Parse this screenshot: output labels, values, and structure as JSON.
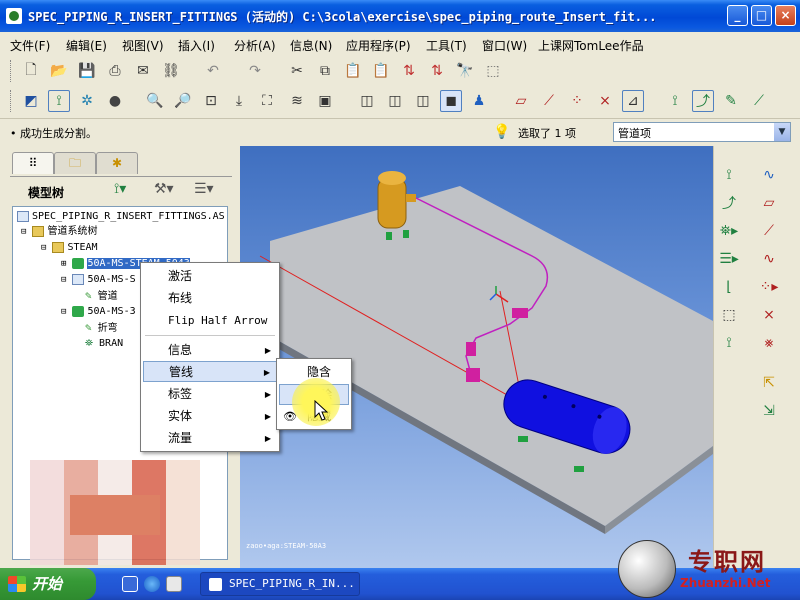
{
  "window": {
    "title": "SPEC_PIPING_R_INSERT_FITTINGS (活动的) C:\\3cola\\exercise\\spec_piping_route_Insert_fit...",
    "min": "_",
    "max": "□",
    "close": "×"
  },
  "menu": [
    "文件(F)",
    "编辑(E)",
    "视图(V)",
    "插入(I)",
    "分析(A)",
    "信息(N)",
    "应用程序(P)",
    "工具(T)",
    "窗口(W)",
    "上课网TomLee作品"
  ],
  "status": {
    "message": "• 成功生成分割。",
    "selected": "选取了 1 项",
    "filter_value": "管道项"
  },
  "panel": {
    "model_tree_label": "模型树"
  },
  "tree": {
    "root": "SPEC_PIPING_R_INSERT_FITTINGS.AS",
    "system": "管道系统树",
    "steam": "STEAM",
    "seg1": "50A-MS-STEAM-5043",
    "seg2": "50A-MS-S",
    "pipe": "管道",
    "seg3": "50A-MS-3",
    "bend": "折弯",
    "branch": "BRAN"
  },
  "context_menu": {
    "activate": "激活",
    "route": "布线",
    "flip": "Flip Half Arrow",
    "info": "信息",
    "pipeline": "管线",
    "label": "标签",
    "solid": "实体",
    "flow": "流量"
  },
  "sub_menu": {
    "hide": "隐含",
    "delete": "删除",
    "blank": "隐藏"
  },
  "viewport": {
    "status_text": "zaoo•aga:STEAM-50A3"
  },
  "taskbar": {
    "start": "开始",
    "task": "SPEC_PIPING_R_IN..."
  },
  "watermark": {
    "text": "专职网",
    "url": "Zhuanzhi.Net"
  },
  "colors": {
    "viewport_top": "#3f6fc0",
    "tank_blue": "#1010e0",
    "tank_orange": "#d69a20",
    "pipe_magenta": "#c020c0",
    "selection": "#316ac5"
  }
}
